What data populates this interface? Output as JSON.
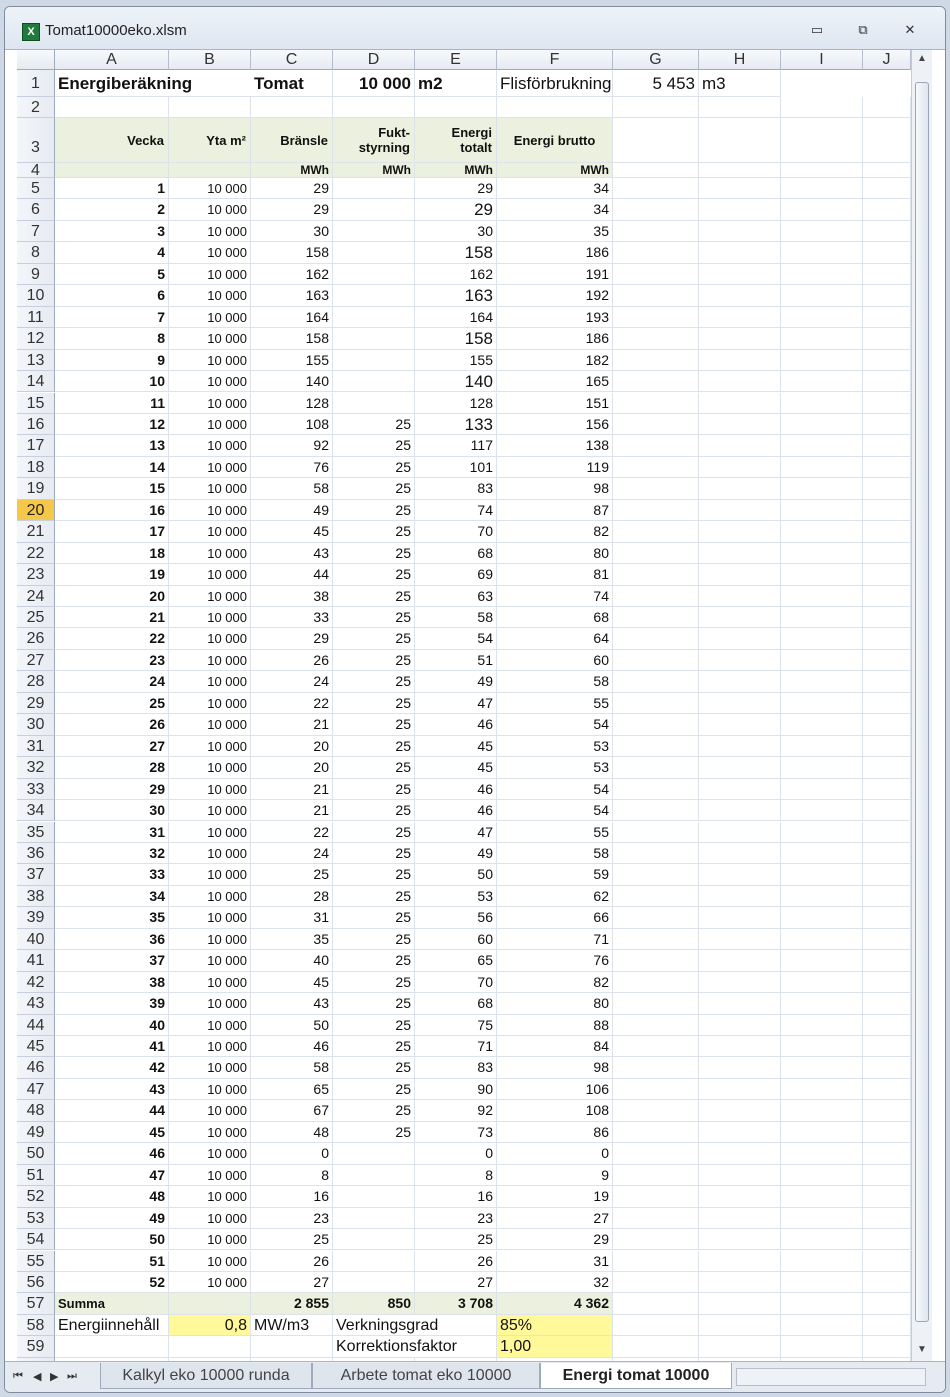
{
  "window": {
    "title": "Tomat10000eko.xlsm",
    "icon": "excel-icon"
  },
  "columns": [
    "A",
    "B",
    "C",
    "D",
    "E",
    "F",
    "G",
    "H",
    "I",
    "J"
  ],
  "header": {
    "title": "Energiberäkning",
    "crop": "Tomat",
    "area": "10 000",
    "area_unit": "m2",
    "chip_label": "Flisförbrukning",
    "chip_value": "5 453",
    "chip_unit": "m3"
  },
  "table_header": {
    "vecka": "Vecka",
    "yta": "Yta m²",
    "bransle": "Bränsle",
    "fukt": "Fukt-styrning",
    "energi_totalt": "Energi totalt",
    "energi_brutto": "Energi brutto",
    "unit": "MWh"
  },
  "weeks": [
    {
      "v": "1",
      "yta": "10 000",
      "br": "29",
      "fu": "",
      "tot": "29",
      "brutto": "34"
    },
    {
      "v": "2",
      "yta": "10 000",
      "br": "29",
      "fu": "",
      "tot": "29",
      "brutto": "34"
    },
    {
      "v": "3",
      "yta": "10 000",
      "br": "30",
      "fu": "",
      "tot": "30",
      "brutto": "35"
    },
    {
      "v": "4",
      "yta": "10 000",
      "br": "158",
      "fu": "",
      "tot": "158",
      "brutto": "186"
    },
    {
      "v": "5",
      "yta": "10 000",
      "br": "162",
      "fu": "",
      "tot": "162",
      "brutto": "191"
    },
    {
      "v": "6",
      "yta": "10 000",
      "br": "163",
      "fu": "",
      "tot": "163",
      "brutto": "192"
    },
    {
      "v": "7",
      "yta": "10 000",
      "br": "164",
      "fu": "",
      "tot": "164",
      "brutto": "193"
    },
    {
      "v": "8",
      "yta": "10 000",
      "br": "158",
      "fu": "",
      "tot": "158",
      "brutto": "186"
    },
    {
      "v": "9",
      "yta": "10 000",
      "br": "155",
      "fu": "",
      "tot": "155",
      "brutto": "182"
    },
    {
      "v": "10",
      "yta": "10 000",
      "br": "140",
      "fu": "",
      "tot": "140",
      "brutto": "165"
    },
    {
      "v": "11",
      "yta": "10 000",
      "br": "128",
      "fu": "",
      "tot": "128",
      "brutto": "151"
    },
    {
      "v": "12",
      "yta": "10 000",
      "br": "108",
      "fu": "25",
      "tot": "133",
      "brutto": "156"
    },
    {
      "v": "13",
      "yta": "10 000",
      "br": "92",
      "fu": "25",
      "tot": "117",
      "brutto": "138"
    },
    {
      "v": "14",
      "yta": "10 000",
      "br": "76",
      "fu": "25",
      "tot": "101",
      "brutto": "119"
    },
    {
      "v": "15",
      "yta": "10 000",
      "br": "58",
      "fu": "25",
      "tot": "83",
      "brutto": "98"
    },
    {
      "v": "16",
      "yta": "10 000",
      "br": "49",
      "fu": "25",
      "tot": "74",
      "brutto": "87"
    },
    {
      "v": "17",
      "yta": "10 000",
      "br": "45",
      "fu": "25",
      "tot": "70",
      "brutto": "82"
    },
    {
      "v": "18",
      "yta": "10 000",
      "br": "43",
      "fu": "25",
      "tot": "68",
      "brutto": "80"
    },
    {
      "v": "19",
      "yta": "10 000",
      "br": "44",
      "fu": "25",
      "tot": "69",
      "brutto": "81"
    },
    {
      "v": "20",
      "yta": "10 000",
      "br": "38",
      "fu": "25",
      "tot": "63",
      "brutto": "74"
    },
    {
      "v": "21",
      "yta": "10 000",
      "br": "33",
      "fu": "25",
      "tot": "58",
      "brutto": "68"
    },
    {
      "v": "22",
      "yta": "10 000",
      "br": "29",
      "fu": "25",
      "tot": "54",
      "brutto": "64"
    },
    {
      "v": "23",
      "yta": "10 000",
      "br": "26",
      "fu": "25",
      "tot": "51",
      "brutto": "60"
    },
    {
      "v": "24",
      "yta": "10 000",
      "br": "24",
      "fu": "25",
      "tot": "49",
      "brutto": "58"
    },
    {
      "v": "25",
      "yta": "10 000",
      "br": "22",
      "fu": "25",
      "tot": "47",
      "brutto": "55"
    },
    {
      "v": "26",
      "yta": "10 000",
      "br": "21",
      "fu": "25",
      "tot": "46",
      "brutto": "54"
    },
    {
      "v": "27",
      "yta": "10 000",
      "br": "20",
      "fu": "25",
      "tot": "45",
      "brutto": "53"
    },
    {
      "v": "28",
      "yta": "10 000",
      "br": "20",
      "fu": "25",
      "tot": "45",
      "brutto": "53"
    },
    {
      "v": "29",
      "yta": "10 000",
      "br": "21",
      "fu": "25",
      "tot": "46",
      "brutto": "54"
    },
    {
      "v": "30",
      "yta": "10 000",
      "br": "21",
      "fu": "25",
      "tot": "46",
      "brutto": "54"
    },
    {
      "v": "31",
      "yta": "10 000",
      "br": "22",
      "fu": "25",
      "tot": "47",
      "brutto": "55"
    },
    {
      "v": "32",
      "yta": "10 000",
      "br": "24",
      "fu": "25",
      "tot": "49",
      "brutto": "58"
    },
    {
      "v": "33",
      "yta": "10 000",
      "br": "25",
      "fu": "25",
      "tot": "50",
      "brutto": "59"
    },
    {
      "v": "34",
      "yta": "10 000",
      "br": "28",
      "fu": "25",
      "tot": "53",
      "brutto": "62"
    },
    {
      "v": "35",
      "yta": "10 000",
      "br": "31",
      "fu": "25",
      "tot": "56",
      "brutto": "66"
    },
    {
      "v": "36",
      "yta": "10 000",
      "br": "35",
      "fu": "25",
      "tot": "60",
      "brutto": "71"
    },
    {
      "v": "37",
      "yta": "10 000",
      "br": "40",
      "fu": "25",
      "tot": "65",
      "brutto": "76"
    },
    {
      "v": "38",
      "yta": "10 000",
      "br": "45",
      "fu": "25",
      "tot": "70",
      "brutto": "82"
    },
    {
      "v": "39",
      "yta": "10 000",
      "br": "43",
      "fu": "25",
      "tot": "68",
      "brutto": "80"
    },
    {
      "v": "40",
      "yta": "10 000",
      "br": "50",
      "fu": "25",
      "tot": "75",
      "brutto": "88"
    },
    {
      "v": "41",
      "yta": "10 000",
      "br": "46",
      "fu": "25",
      "tot": "71",
      "brutto": "84"
    },
    {
      "v": "42",
      "yta": "10 000",
      "br": "58",
      "fu": "25",
      "tot": "83",
      "brutto": "98"
    },
    {
      "v": "43",
      "yta": "10 000",
      "br": "65",
      "fu": "25",
      "tot": "90",
      "brutto": "106"
    },
    {
      "v": "44",
      "yta": "10 000",
      "br": "67",
      "fu": "25",
      "tot": "92",
      "brutto": "108"
    },
    {
      "v": "45",
      "yta": "10 000",
      "br": "48",
      "fu": "25",
      "tot": "73",
      "brutto": "86"
    },
    {
      "v": "46",
      "yta": "10 000",
      "br": "0",
      "fu": "",
      "tot": "0",
      "brutto": "0"
    },
    {
      "v": "47",
      "yta": "10 000",
      "br": "8",
      "fu": "",
      "tot": "8",
      "brutto": "9"
    },
    {
      "v": "48",
      "yta": "10 000",
      "br": "16",
      "fu": "",
      "tot": "16",
      "brutto": "19"
    },
    {
      "v": "49",
      "yta": "10 000",
      "br": "23",
      "fu": "",
      "tot": "23",
      "brutto": "27"
    },
    {
      "v": "50",
      "yta": "10 000",
      "br": "25",
      "fu": "",
      "tot": "25",
      "brutto": "29"
    },
    {
      "v": "51",
      "yta": "10 000",
      "br": "26",
      "fu": "",
      "tot": "26",
      "brutto": "31"
    },
    {
      "v": "52",
      "yta": "10 000",
      "br": "27",
      "fu": "",
      "tot": "27",
      "brutto": "32"
    }
  ],
  "summa": {
    "label": "Summa",
    "bransle": "2 855",
    "fukt": "850",
    "totalt": "3 708",
    "brutto": "4 362"
  },
  "energy_content": {
    "label": "Energiinnehåll",
    "value": "0,8",
    "unit": "MW/m3"
  },
  "efficiency": {
    "label": "Verkningsgrad",
    "value": "85%"
  },
  "correction": {
    "label": "Korrektionsfaktor",
    "value": "1,00"
  },
  "selected_row": "20",
  "sheet_tabs": [
    {
      "label": "Kalkyl eko 10000 runda",
      "active": false
    },
    {
      "label": "Arbete tomat eko 10000",
      "active": false
    },
    {
      "label": "Energi tomat 10000",
      "active": true
    }
  ],
  "colors": {
    "header_fill": "#ebf1de",
    "input_fill": "#fff99a",
    "selected_row": "#f6c84a"
  }
}
